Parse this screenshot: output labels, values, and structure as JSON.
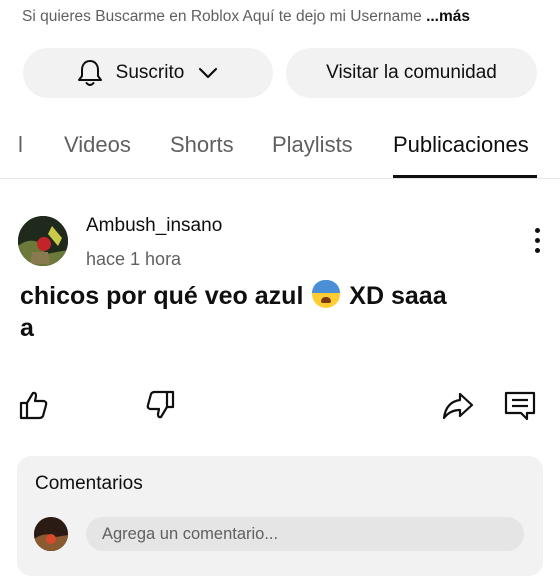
{
  "description": {
    "text": "Si quieres Buscarme en Roblox Aquí te dejo mi Username ",
    "more_label": "...más"
  },
  "buttons": {
    "subscribed_label": "Suscrito",
    "community_label": "Visitar la comunidad"
  },
  "tabs": {
    "partial_label": "l",
    "items": [
      "Videos",
      "Shorts",
      "Playlists",
      "Publicaciones"
    ],
    "active": "Publicaciones"
  },
  "post": {
    "author": "Ambush_insano",
    "time": "hace 1 hora",
    "text_before_emoji": "chicos por qué veo azul ",
    "emoji": "anxious-face-with-sweat",
    "text_after_emoji": " XD saaa",
    "text_line2": "a"
  },
  "actions": {
    "like_icon": "thumbs-up-icon",
    "dislike_icon": "thumbs-down-icon",
    "share_icon": "share-icon",
    "comment_icon": "comment-icon"
  },
  "comments": {
    "title": "Comentarios",
    "placeholder": "Agrega un comentario..."
  }
}
